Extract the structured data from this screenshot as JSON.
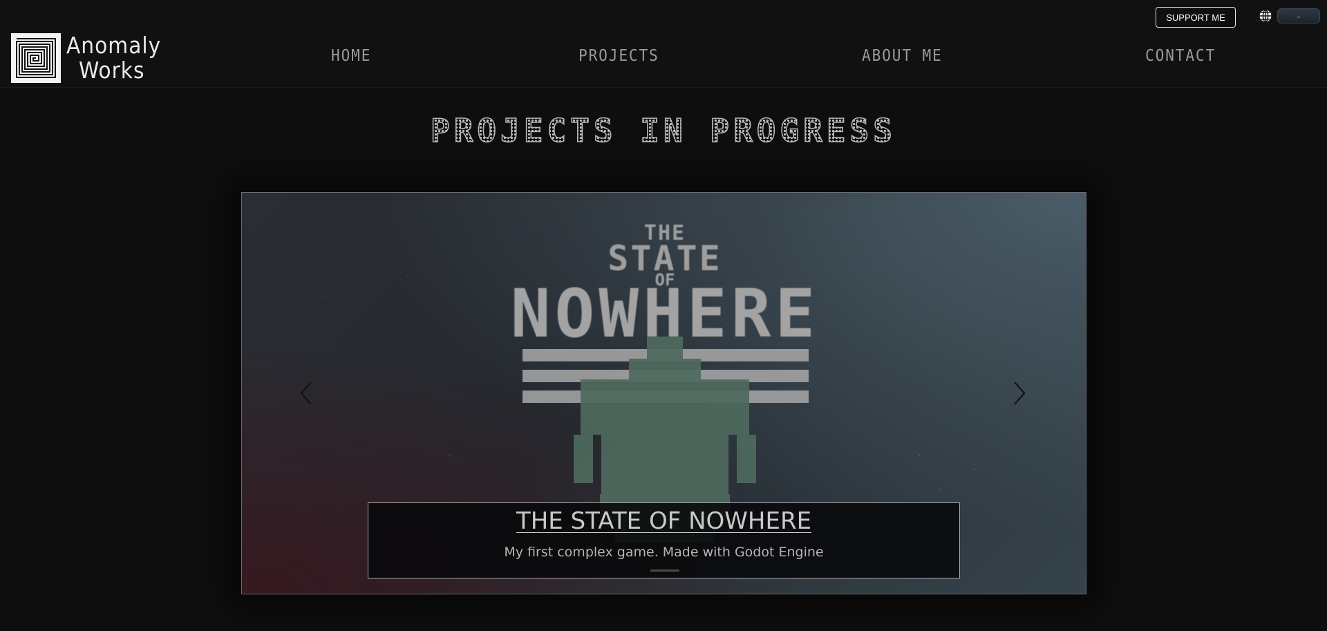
{
  "brand": {
    "name_line1": "Anomaly",
    "name_line2": "Works",
    "logo_icon": "square-spiral-logo-icon"
  },
  "nav": {
    "items": [
      {
        "label": "HOME"
      },
      {
        "label": "PROJECTS"
      },
      {
        "label": "ABOUT ME"
      },
      {
        "label": "CONTACT"
      }
    ]
  },
  "topbar": {
    "support_label": "SUPPORT ME",
    "language_icon": "globe-icon",
    "language_select_icon": "chevron-down-icon"
  },
  "main": {
    "title": "PROJECTS IN PROGRESS"
  },
  "carousel": {
    "prev_icon": "chevron-left-icon",
    "next_icon": "chevron-right-icon",
    "slides": [
      {
        "art_line1": "THE",
        "art_line2": "STATE",
        "art_line3": "OF",
        "art_line4": "NOWHERE",
        "title": "THE STATE OF NOWHERE",
        "subtitle": "My first complex game. Made with Godot Engine"
      }
    ]
  },
  "colors": {
    "background": "#0e0e0f",
    "header": "#111112",
    "caption_border": "#a8a8a8",
    "eagle": "#4f6a5e"
  }
}
